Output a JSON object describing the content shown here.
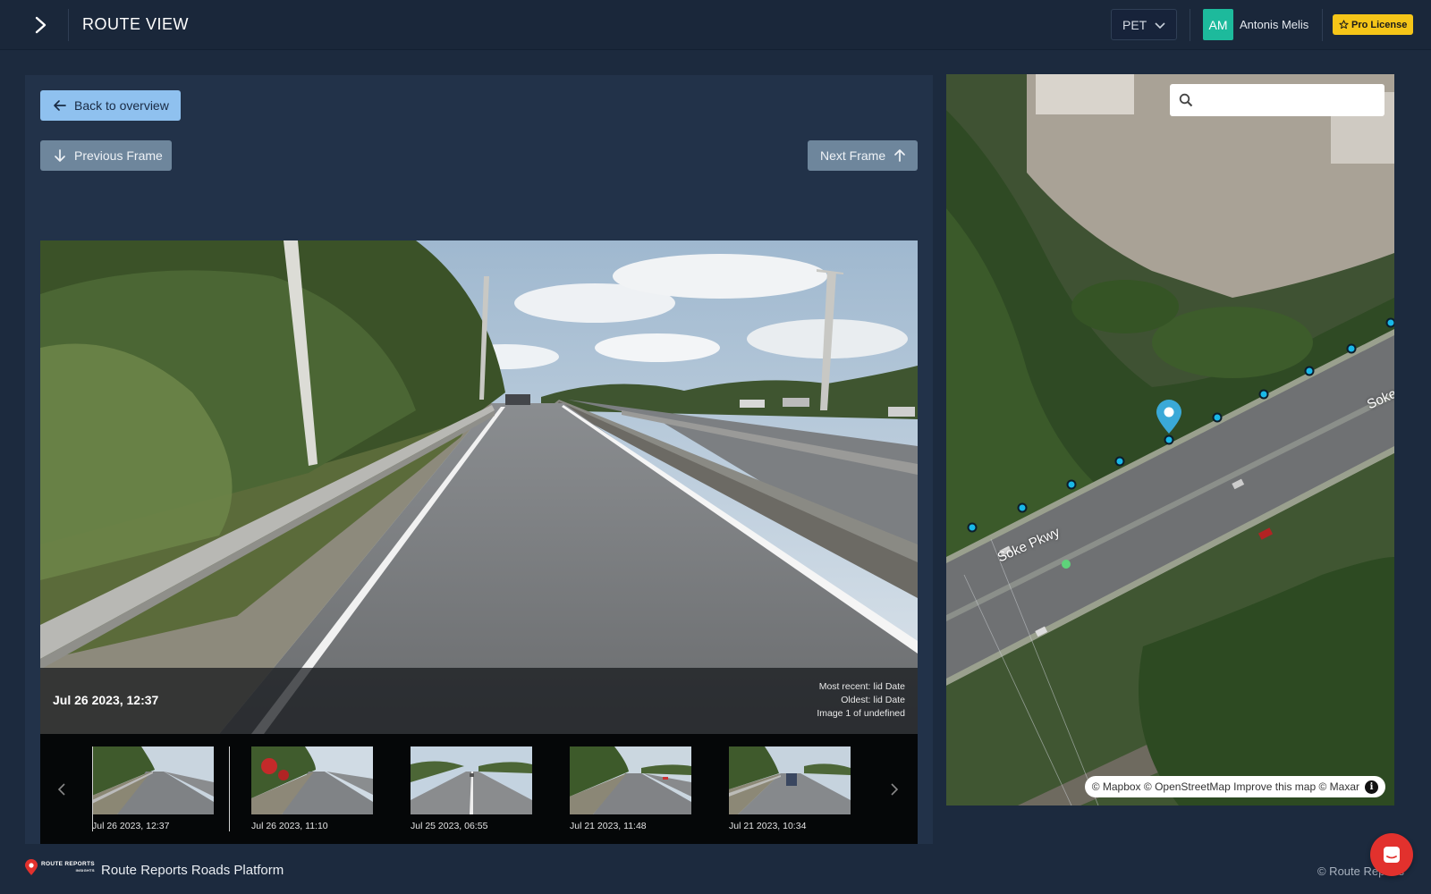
{
  "header": {
    "title": "ROUTE VIEW",
    "region": "PET",
    "user_initials": "AM",
    "user_name": "Antonis Melis",
    "license": "Pro License"
  },
  "toolbar": {
    "back_label": "Back to overview",
    "prev_label": "Previous Frame",
    "next_label": "Next Frame"
  },
  "viewer": {
    "date": "Jul 26 2023, 12:37",
    "most_recent": "Most recent: lid Date",
    "oldest": "Oldest: lid Date",
    "image_index": "Image 1 of undefined"
  },
  "thumbnails": [
    {
      "label": "Jul 26 2023, 12:37",
      "active": true
    },
    {
      "label": "Jul 26 2023, 11:10",
      "active": false
    },
    {
      "label": "Jul 25 2023, 06:55",
      "active": false
    },
    {
      "label": "Jul 21 2023, 11:48",
      "active": false
    },
    {
      "label": "Jul 21 2023, 10:34",
      "active": false
    }
  ],
  "map": {
    "search_placeholder": "",
    "road_label": "Soke Pkwy",
    "road_label_2": "Soke",
    "attribution": "© Mapbox © OpenStreetMap Improve this map © Maxar"
  },
  "footer": {
    "logo_line1": "ROUTE REPORTS",
    "logo_line2": "INSIGHTS",
    "app_name": "Route Reports Roads Platform",
    "copyright": "© Route Reports"
  },
  "colors": {
    "accent": "#8fc1ef",
    "badge": "#f5c518",
    "avatar": "#1dba9c",
    "chat": "#e2312d",
    "map_point": "#19b8e8"
  }
}
